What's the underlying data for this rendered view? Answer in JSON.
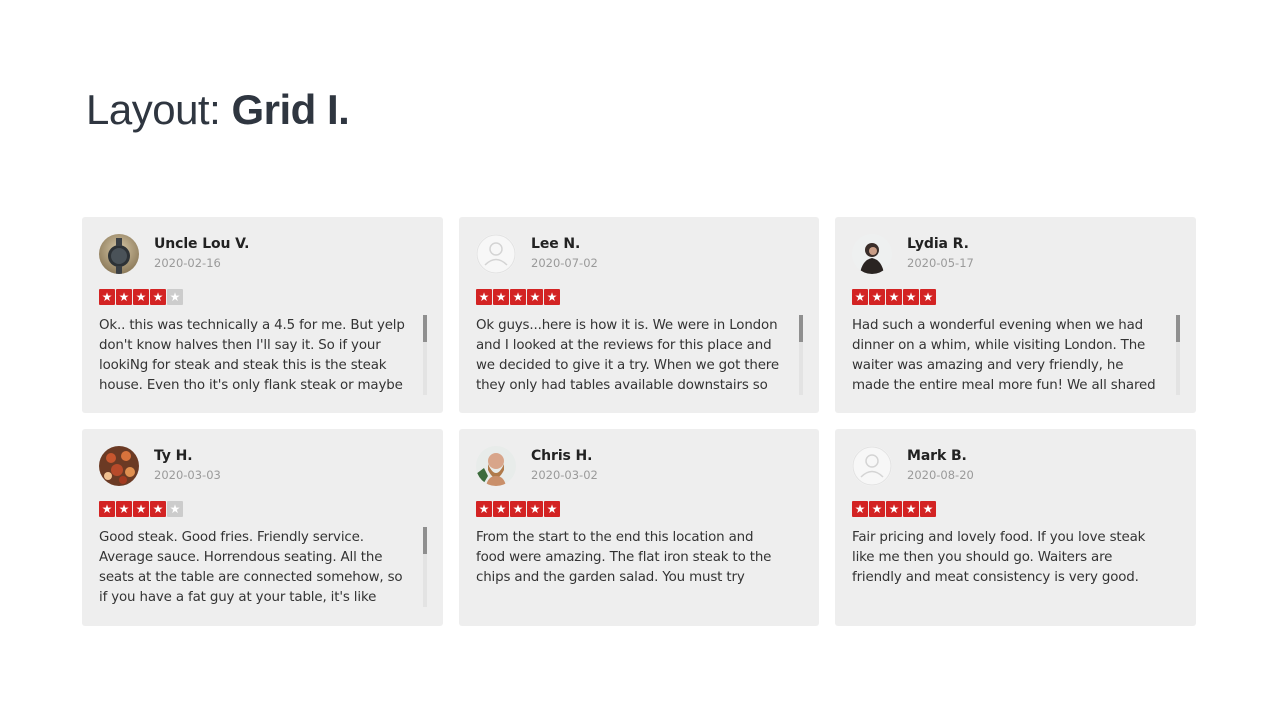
{
  "heading": {
    "prefix": "Layout: ",
    "emphasis": "Grid I."
  },
  "colors": {
    "star_on": "#d32323",
    "star_off": "#cccccc",
    "card_bg": "#eeeeee"
  },
  "reviews": [
    {
      "name": "Uncle Lou V.",
      "date": "2020-02-16",
      "rating": 4,
      "avatar": "watch-photo-avatar",
      "scrollable": true,
      "text": "Ok.. this was technically a 4.5 for me. But yelp don't know halves then I'll say it. So if your lookiNg for steak and steak this is the steak house. Even tho it's only flank steak or maybe"
    },
    {
      "name": "Lee N.",
      "date": "2020-07-02",
      "rating": 5,
      "avatar": "default-user-avatar",
      "scrollable": true,
      "text": "Ok guys...here is how it is. We were in London and I looked at the reviews for this place and we decided to give it a try. When we got there they only had tables available downstairs so we"
    },
    {
      "name": "Lydia R.",
      "date": "2020-05-17",
      "rating": 5,
      "avatar": "person-photo-avatar",
      "scrollable": true,
      "text": "Had such a wonderful evening when we had dinner on a whim, while visiting London. The waiter was amazing and very friendly, he made the entire meal more fun! We all shared our"
    },
    {
      "name": "Ty H.",
      "date": "2020-03-03",
      "rating": 4,
      "avatar": "food-photo-avatar",
      "scrollable": true,
      "text": "Good steak. Good fries. Friendly service. Average sauce. Horrendous seating. All the seats at the table are connected somehow, so if you have a fat guy at your table, it's like being"
    },
    {
      "name": "Chris H.",
      "date": "2020-03-02",
      "rating": 5,
      "avatar": "bearded-man-photo-avatar",
      "scrollable": false,
      "text": "From the start to the end this location and food were amazing. The flat iron steak to the chips and the garden salad. You must try"
    },
    {
      "name": "Mark B.",
      "date": "2020-08-20",
      "rating": 5,
      "avatar": "default-user-avatar",
      "scrollable": false,
      "text": "Fair pricing and lovely food. If you love steak like me then you should go. Waiters are friendly and meat consistency is very good."
    }
  ]
}
